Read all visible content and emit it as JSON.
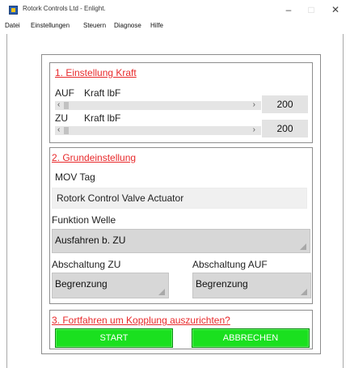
{
  "window": {
    "title": "Rotork Controls Ltd - Enlight.",
    "minimize_glyph": "–",
    "maximize_glyph": "□",
    "close_glyph": "✕"
  },
  "menu": {
    "items": [
      "Datei",
      "Einstellungen",
      "Steuern",
      "Diagnose",
      "Hilfe"
    ]
  },
  "section1": {
    "title": "1. Einstellung Kraft",
    "auf": {
      "direction": "AUF",
      "label": "Kraft lbF",
      "value": "200",
      "left_arrow": "‹",
      "right_arrow": "›"
    },
    "zu": {
      "direction": "ZU",
      "label": "Kraft lbF",
      "value": "200",
      "left_arrow": "‹",
      "right_arrow": "›"
    }
  },
  "section2": {
    "title": "2. Grundeinstellung",
    "mov_tag_label": "MOV Tag",
    "mov_tag_value": "Rotork Control Valve Actuator",
    "funktion_label": "Funktion Welle",
    "funktion_value": "Ausfahren b. ZU",
    "abschaltung_zu_label": "Abschaltung ZU",
    "abschaltung_zu_value": "Begrenzung",
    "abschaltung_auf_label": "Abschaltung AUF",
    "abschaltung_auf_value": "Begrenzung"
  },
  "section3": {
    "title": "3. Fortfahren um Kopplung auszurichten?",
    "start_label": "START",
    "abbrechen_label": "ABBRECHEN"
  },
  "colors": {
    "section_title": "#e8292b",
    "button_green": "#1ae01f",
    "combo_bg": "#d7d7d7"
  },
  "icons": {
    "app": "rotork-app-icon",
    "combo_arrow": "chevron-down-icon"
  }
}
